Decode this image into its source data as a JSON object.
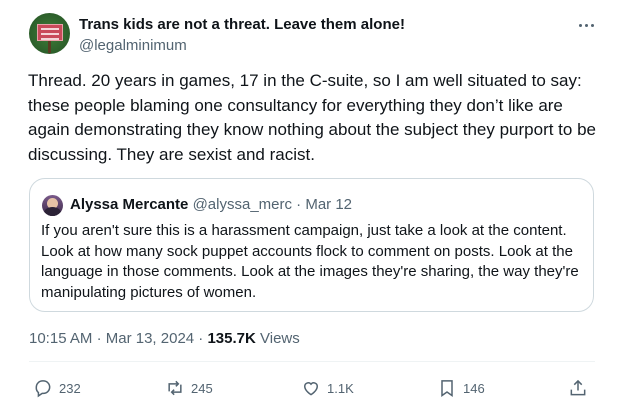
{
  "tweet": {
    "display_name": "Trans kids are not a threat. Leave them alone!",
    "handle": "@legalminimum",
    "text": "Thread. 20 years in games, 17 in the C-suite, so I am well situated to say: these people blaming one consultancy for everything they don’t like are again demonstrating they know nothing about the subject they purport to be discussing. They are sexist and racist.",
    "time": "10:15 AM",
    "date": "Mar 13, 2024",
    "views_count": "135.7K",
    "views_label": "Views"
  },
  "quote": {
    "name": "Alyssa Mercante",
    "handle": "@alyssa_merc",
    "date": "Mar 12",
    "text": "If you aren't sure this is a harassment campaign, just take a look at the content. Look at how many sock puppet accounts flock to comment on posts. Look at the language in those comments. Look at the images they're sharing, the way they're manipulating pictures of women."
  },
  "actions": {
    "replies": "232",
    "reposts": "245",
    "likes": "1.1K",
    "bookmarks": "146"
  },
  "icons": [
    "more-icon",
    "reply-icon",
    "repost-icon",
    "like-icon",
    "bookmark-icon",
    "share-icon"
  ],
  "colors": {
    "text": "#0f1419",
    "secondary": "#536471",
    "border": "#cfd9de"
  }
}
